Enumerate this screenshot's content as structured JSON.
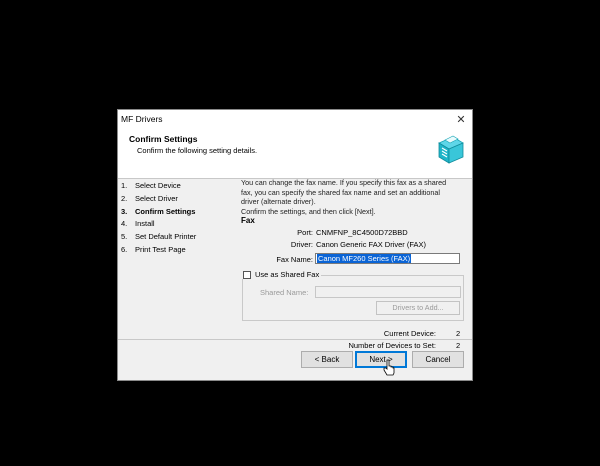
{
  "window": {
    "title": "MF Drivers",
    "close_glyph": "✕"
  },
  "header": {
    "title": "Confirm Settings",
    "subtitle": "Confirm the following setting details.",
    "icon": "printer-icon"
  },
  "steps": [
    {
      "num": "1.",
      "label": "Select Device",
      "active": false
    },
    {
      "num": "2.",
      "label": "Select Driver",
      "active": false
    },
    {
      "num": "3.",
      "label": "Confirm Settings",
      "active": true
    },
    {
      "num": "4.",
      "label": "Install",
      "active": false
    },
    {
      "num": "5.",
      "label": "Set Default Printer",
      "active": false
    },
    {
      "num": "6.",
      "label": "Print Test Page",
      "active": false
    }
  ],
  "content": {
    "desc_lines": [
      "You can change the fax name. If you specify this fax as a shared",
      "fax, you can specify the shared fax name and set an additional",
      "driver (alternate driver).",
      "Confirm the settings, and then click [Next]."
    ],
    "section_title": "Fax",
    "port_label": "Port:",
    "port_value": "CNMFNP_8C4500D72BBD",
    "driver_label": "Driver:",
    "driver_value": "Canon Generic FAX Driver (FAX)",
    "fax_name_label": "Fax Name:",
    "fax_name_value": "Canon MF260 Series (FAX)",
    "shared_fax_checkbox_label": "Use as Shared Fax",
    "shared_fax_checked": false,
    "shared_name_label": "Shared Name:",
    "shared_name_value": "",
    "drivers_to_add_label": "Drivers to Add...",
    "current_device_label": "Current Device:",
    "current_device_value": "2",
    "devices_to_set_label": "Number of Devices to Set:",
    "devices_to_set_value": "2"
  },
  "footer": {
    "back_label": "< Back",
    "next_label": "Next >",
    "cancel_label": "Cancel"
  },
  "colors": {
    "selection": "#0a64d6",
    "default_button_border": "#0078d7",
    "background": "#000000",
    "dialog": "#f0f0f0"
  }
}
